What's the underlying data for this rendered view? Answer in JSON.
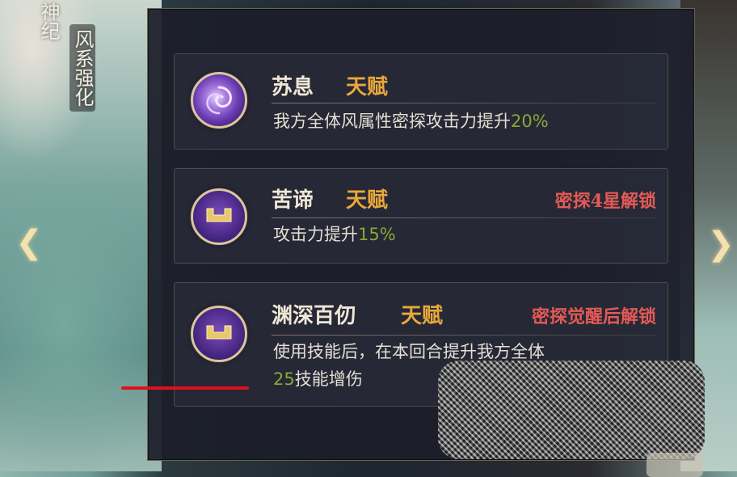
{
  "side_tags": {
    "tag1": "神纪",
    "tag2": "风系强化"
  },
  "navigation": {
    "left_arrow": "❮",
    "right_arrow": "❯"
  },
  "skills": [
    {
      "name": "苏息",
      "type": "天赋",
      "unlock": "",
      "description": "我方全体风属性密探攻击力提升",
      "value": "20%",
      "icon": "swirl-icon"
    },
    {
      "name": "苦谛",
      "type": "天赋",
      "unlock": "密探4星解锁",
      "description": "攻击力提升",
      "value": "15%",
      "icon": "lock-icon"
    },
    {
      "name": "渊深百仞",
      "type": "天赋",
      "unlock": "密探觉醒后解锁",
      "description_line1": "使用技能后，在本回合提升我方全体",
      "value": "25",
      "description_line2": "技能增伤",
      "icon": "lock-icon"
    }
  ],
  "colors": {
    "talent": "#e8a93a",
    "unlock": "#e35a55",
    "highlight": "#8aa832",
    "underline": "#e0101a"
  }
}
